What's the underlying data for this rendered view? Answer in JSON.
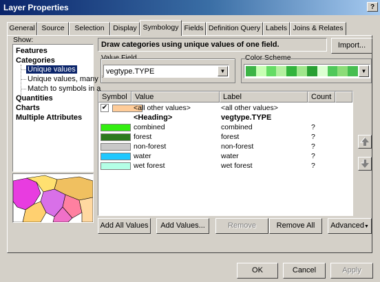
{
  "window": {
    "title": "Layer Properties",
    "help_label": "?"
  },
  "tabs": [
    "General",
    "Source",
    "Selection",
    "Display",
    "Symbology",
    "Fields",
    "Definition Query",
    "Labels",
    "Joins & Relates"
  ],
  "show_panel": {
    "label": "Show:",
    "items": [
      "Features",
      "Categories",
      "Unique values",
      "Unique values, many f",
      "Match to symbols in a",
      "Quantities",
      "Charts",
      "Multiple Attributes"
    ]
  },
  "header": {
    "description": "Draw categories using unique values of one field.",
    "import_label": "Import..."
  },
  "value_field": {
    "label": "Value Field",
    "value": "vegtype.TYPE"
  },
  "color_scheme": {
    "label": "Color Scheme",
    "colors": [
      "#3cb446",
      "#c8ffb4",
      "#64dc64",
      "#b4f0a0",
      "#32b43c",
      "#a0e68c",
      "#28a032",
      "#dcffd2",
      "#50c85a",
      "#8cdc78",
      "#46be50"
    ]
  },
  "table": {
    "columns": [
      "Symbol",
      "Value",
      "Label",
      "Count"
    ],
    "rows": [
      {
        "color": "#ffcc99",
        "checked": true,
        "value": "<all other values>",
        "label": "<all other values>",
        "count": "",
        "bold": false,
        "swatch": true
      },
      {
        "color": "",
        "checked": false,
        "value": "<Heading>",
        "label": "vegtype.TYPE",
        "count": "",
        "bold": true,
        "swatch": false
      },
      {
        "color": "#33ee11",
        "checked": false,
        "value": "combined",
        "label": "combined",
        "count": "?",
        "bold": false,
        "swatch": true
      },
      {
        "color": "#2d7a1e",
        "checked": false,
        "value": "forest",
        "label": "forest",
        "count": "?",
        "bold": false,
        "swatch": true
      },
      {
        "color": "#c8c8c8",
        "checked": false,
        "value": "non-forest",
        "label": "non-forest",
        "count": "?",
        "bold": false,
        "swatch": true
      },
      {
        "color": "#1ec8ff",
        "checked": false,
        "value": "water",
        "label": "water",
        "count": "?",
        "bold": false,
        "swatch": true
      },
      {
        "color": "#b4ffe6",
        "checked": false,
        "value": "wet forest",
        "label": "wet forest",
        "count": "?",
        "bold": false,
        "swatch": true
      }
    ]
  },
  "buttons": {
    "add_all": "Add All Values",
    "add_values": "Add Values...",
    "remove": "Remove",
    "remove_all": "Remove All",
    "advanced": "Advanced"
  },
  "footer": {
    "ok": "OK",
    "cancel": "Cancel",
    "apply": "Apply"
  }
}
